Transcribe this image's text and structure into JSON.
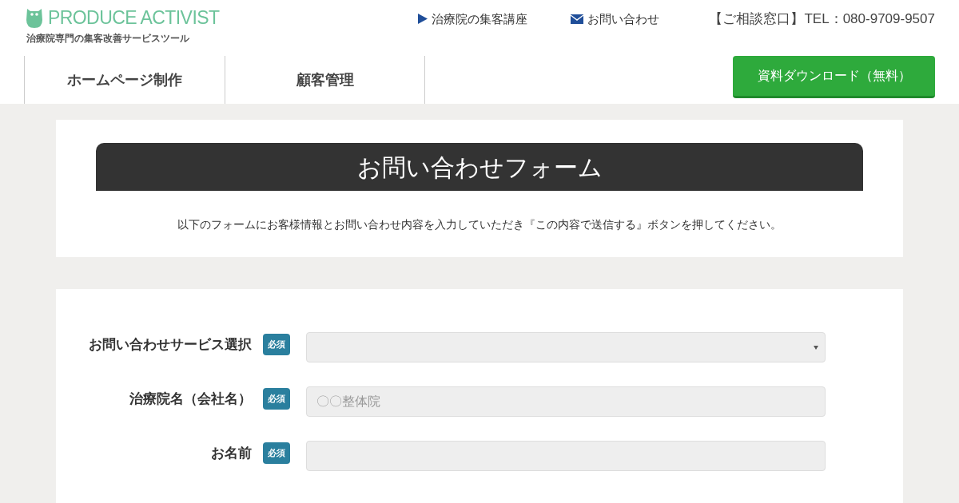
{
  "header": {
    "logo": "PRODUCE ACTIVIST",
    "tagline": "治療院専門の集客改善サービスツール",
    "links": [
      {
        "kind": "play",
        "label": "治療院の集客講座"
      },
      {
        "kind": "mail",
        "label": "お問い合わせ"
      }
    ],
    "phone": "【ご相談窓口】TEL：080-9709-9507"
  },
  "nav": {
    "items": [
      "ホームページ制作",
      "顧客管理"
    ],
    "cta": "資料ダウンロード（無料）"
  },
  "intro": {
    "title": "お問い合わせフォーム",
    "text": "以下のフォームにお客様情報とお問い合わせ内容を入力していただき『この内容で送信する』ボタンを押してください。"
  },
  "form": {
    "fields": [
      {
        "kind": "select",
        "label": "お問い合わせサービス選択",
        "badge": "必須"
      },
      {
        "kind": "text",
        "label": "治療院名（会社名）",
        "badge": "必須",
        "placeholder": "〇〇整体院"
      },
      {
        "kind": "text",
        "label": "お名前",
        "badge": "必須"
      }
    ]
  }
}
